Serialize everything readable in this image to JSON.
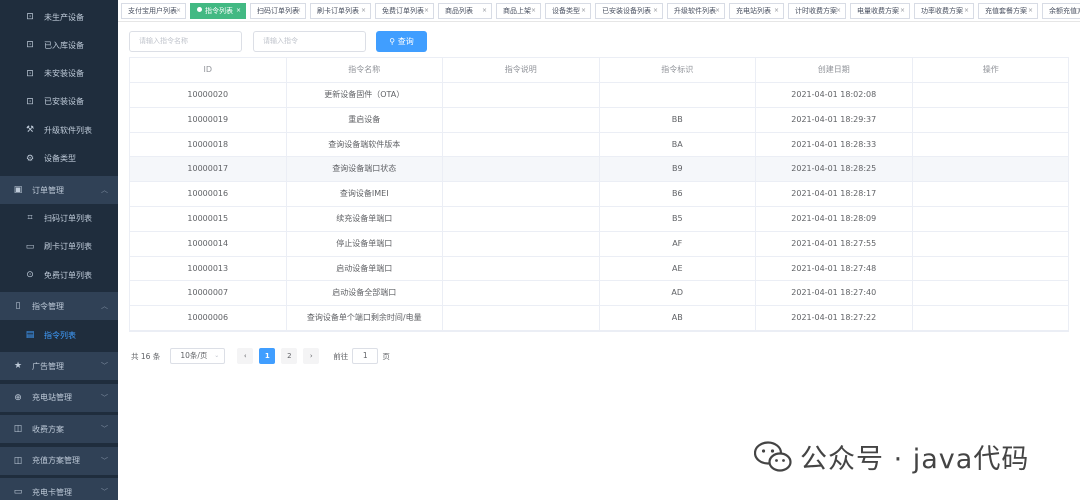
{
  "sidebar": {
    "items": [
      {
        "label": "未生产设备",
        "icon": "lock-icon"
      },
      {
        "label": "已入库设备",
        "icon": "lock-icon"
      },
      {
        "label": "未安装设备",
        "icon": "lock-icon"
      },
      {
        "label": "已安装设备",
        "icon": "lock-icon"
      },
      {
        "label": "升级软件列表",
        "icon": "wrench-icon"
      },
      {
        "label": "设备类型",
        "icon": "gear-icon"
      }
    ],
    "order_group": {
      "label": "订单管理",
      "icon": "bag-icon"
    },
    "order_items": [
      {
        "label": "扫码订单列表",
        "icon": "scan-icon"
      },
      {
        "label": "刷卡订单列表",
        "icon": "card-icon"
      },
      {
        "label": "免费订单列表",
        "icon": "coin-icon"
      }
    ],
    "cmd_group": {
      "label": "指令管理",
      "icon": "tablet-icon"
    },
    "cmd_items": [
      {
        "label": "指令列表",
        "icon": "document-icon"
      }
    ],
    "groups": [
      {
        "label": "广告管理",
        "icon": "star-icon"
      },
      {
        "label": "充电站管理",
        "icon": "plus-circle-icon"
      },
      {
        "label": "收费方案",
        "icon": "book-icon"
      },
      {
        "label": "充值方案管理",
        "icon": "book-icon"
      },
      {
        "label": "充电卡管理",
        "icon": "card-icon"
      }
    ]
  },
  "tabs": [
    "支付宝用户列表",
    "指令列表",
    "扫码订单列表",
    "刷卡订单列表",
    "免费订单列表",
    "商品列表",
    "商品上架",
    "设备类型",
    "已安装设备列表",
    "升级软件列表",
    "充电站列表",
    "计时收费方案",
    "电量收费方案",
    "功率收费方案",
    "充值套餐方案",
    "余额充值方"
  ],
  "search": {
    "name_placeholder": "请输入指令名称",
    "code_placeholder": "请输入指令",
    "button_label": "查询"
  },
  "table": {
    "columns": [
      "ID",
      "指令名称",
      "指令说明",
      "指令标识",
      "创建日期",
      "操作"
    ],
    "rows": [
      [
        "10000020",
        "更新设备固件（OTA）",
        "",
        "",
        "2021-04-01 18:02:08",
        ""
      ],
      [
        "10000019",
        "重启设备",
        "",
        "BB",
        "2021-04-01 18:29:37",
        ""
      ],
      [
        "10000018",
        "查询设备端软件版本",
        "",
        "BA",
        "2021-04-01 18:28:33",
        ""
      ],
      [
        "10000017",
        "查询设备端口状态",
        "",
        "B9",
        "2021-04-01 18:28:25",
        ""
      ],
      [
        "10000016",
        "查询设备IMEI",
        "",
        "B6",
        "2021-04-01 18:28:17",
        ""
      ],
      [
        "10000015",
        "续充设备单端口",
        "",
        "B5",
        "2021-04-01 18:28:09",
        ""
      ],
      [
        "10000014",
        "停止设备单端口",
        "",
        "AF",
        "2021-04-01 18:27:55",
        ""
      ],
      [
        "10000013",
        "启动设备单端口",
        "",
        "AE",
        "2021-04-01 18:27:48",
        ""
      ],
      [
        "10000007",
        "启动设备全部端口",
        "",
        "AD",
        "2021-04-01 18:27:40",
        ""
      ],
      [
        "10000006",
        "查询设备单个端口剩余时间/电量",
        "",
        "AB",
        "2021-04-01 18:27:22",
        ""
      ]
    ]
  },
  "pagination": {
    "total": "共 16 条",
    "page_size": "10条/页",
    "pages": [
      "1",
      "2"
    ],
    "current": "1",
    "goto_prefix": "前往",
    "goto_value": "1",
    "goto_suffix": "页"
  },
  "watermark": {
    "text": "公众号 · java代码"
  },
  "colors": {
    "sidebar": "#1f2d3d",
    "active_tab": "#42b983",
    "primary": "#409eff"
  }
}
